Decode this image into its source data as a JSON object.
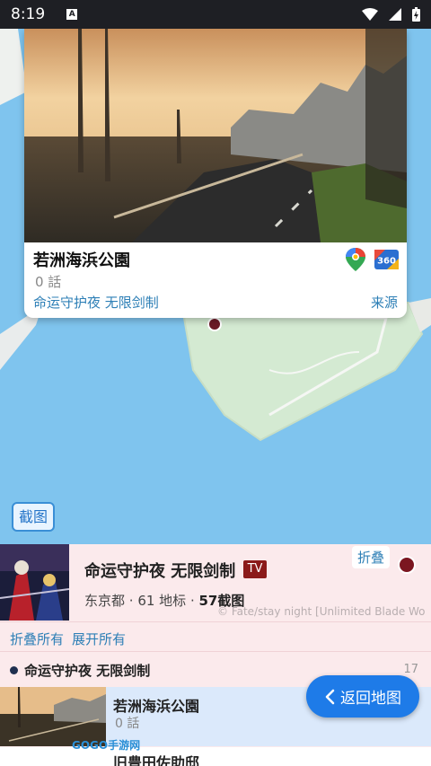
{
  "status_bar": {
    "time": "8:19"
  },
  "card": {
    "title": "若洲海浜公園",
    "episode": "0 話",
    "anime_link": "命运守护夜 无限剑制",
    "source_link": "来源"
  },
  "map": {
    "screenshot_button": "截图"
  },
  "panel": {
    "anime_title": "命运守护夜 无限剑制",
    "badge": "TV",
    "collapse_button": "折叠",
    "stats": {
      "region": "东京都",
      "sep1": " · ",
      "points": "61 地标",
      "sep2": " · ",
      "screens": "57截图"
    },
    "credit": "© Fate/stay night [Unlimited Blade Wor...",
    "fold_all": "折叠所有",
    "expand_all": "展开所有",
    "group": {
      "title": "命运守护夜 无限剑制",
      "count": "17"
    },
    "items": [
      {
        "name": "若洲海浜公園",
        "episode": "0 話"
      },
      {
        "name": "旧豊田佐助邸"
      }
    ]
  },
  "back_button": "返回地图",
  "watermark": "GOGO手游网",
  "colors": {
    "accent_blue": "#2d7fb6",
    "button_blue": "#1e7be8",
    "badge_red": "#8b1a1a",
    "panel_bg": "#fbeaec"
  }
}
